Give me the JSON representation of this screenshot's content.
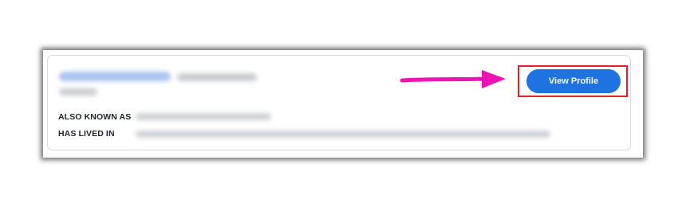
{
  "card": {
    "also_known_as_label": "ALSO KNOWN AS",
    "has_lived_in_label": "HAS LIVED IN",
    "view_profile_label": "View Profile"
  },
  "colors": {
    "button_blue": "#1f73e0",
    "highlight_red": "#e4212b",
    "arrow_magenta": "#f013b4"
  },
  "icons": {
    "annotation_arrow": "arrow-right-icon"
  }
}
